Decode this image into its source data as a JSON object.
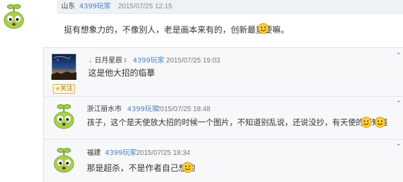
{
  "top_comment": {
    "user": "山东",
    "tag": "4399玩家",
    "time": "2015/07/25  12:15",
    "text": "挺有想象力的，不像别人，老是画本来有的，创新最重要嘛。"
  },
  "replies": [
    {
      "user": "日月星辰",
      "level": "Ⅱ",
      "level_prefix": "♩",
      "tag": "4399玩家",
      "time": "2015/07/25  19:03",
      "text": "这是他大招的临摹",
      "follow_label": "关注"
    },
    {
      "user": "浙江丽水市",
      "tag": "4399玩家",
      "time": "2015/07/25  18:48",
      "text": "孩子，这个是天使放大招的时候一个图片，不知道别乱说，还说没抄，有天使的都知道"
    },
    {
      "user": "福建",
      "tag": "4399玩家",
      "time": "2015/07/25  18:34",
      "text": "那是超杀，不是作者自己想的"
    }
  ],
  "icons": {
    "avatar": "sprout-mascot-avatar",
    "avatar_photo": "night-sky-avatar",
    "emoticon": "smile-emoticon",
    "follow": "star-icon"
  },
  "colors": {
    "tag_link": "#4a7fc1",
    "header_bar": "#eef2f7",
    "reply_bg": "#f7f8fa",
    "border": "#dde2e8"
  }
}
